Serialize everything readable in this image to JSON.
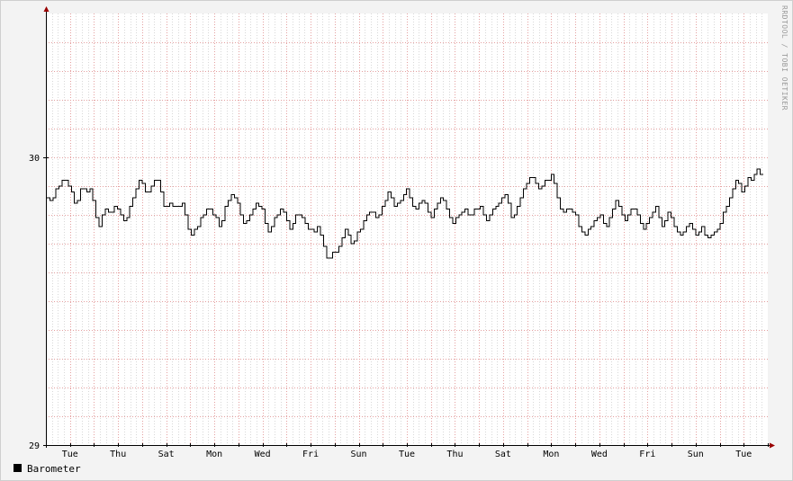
{
  "chart_data": {
    "type": "line",
    "watermark": "RRDTOOL / TOBI OETIKER",
    "x_tick_labels": [
      "Tue",
      "Thu",
      "Sat",
      "Mon",
      "Wed",
      "Fri",
      "Sun",
      "Tue",
      "Thu",
      "Sat",
      "Mon",
      "Wed",
      "Fri",
      "Sun",
      "Tue"
    ],
    "y_tick_labels": [
      "29",
      "30"
    ],
    "y_ticks": [
      29,
      30
    ],
    "ylim": [
      29,
      30.5
    ],
    "x_range_days": [
      0,
      30
    ],
    "x_tick_days": [
      1,
      3,
      5,
      7,
      9,
      11,
      13,
      15,
      17,
      19,
      21,
      23,
      25,
      27,
      29
    ],
    "grid": true,
    "legend_placement": "bottom-left",
    "colors": {
      "background": "#f3f3f3",
      "canvas": "#ffffff",
      "line": "#000000",
      "grid_minor": "#d8d8d8",
      "grid_major": "#e4a0a0",
      "axis": "#000000",
      "arrow": "#990000"
    },
    "series": [
      {
        "name": "Barometer",
        "color": "#000000",
        "values": [
          29.86,
          29.85,
          29.86,
          29.89,
          29.9,
          29.92,
          29.92,
          29.9,
          29.88,
          29.84,
          29.85,
          29.89,
          29.89,
          29.88,
          29.89,
          29.85,
          29.79,
          29.76,
          29.8,
          29.82,
          29.81,
          29.81,
          29.83,
          29.82,
          29.8,
          29.78,
          29.79,
          29.83,
          29.86,
          29.89,
          29.92,
          29.91,
          29.88,
          29.88,
          29.9,
          29.92,
          29.92,
          29.88,
          29.83,
          29.83,
          29.84,
          29.83,
          29.83,
          29.83,
          29.84,
          29.8,
          29.75,
          29.73,
          29.75,
          29.76,
          29.79,
          29.8,
          29.82,
          29.82,
          29.8,
          29.79,
          29.76,
          29.78,
          29.83,
          29.85,
          29.87,
          29.86,
          29.84,
          29.8,
          29.77,
          29.78,
          29.8,
          29.82,
          29.84,
          29.83,
          29.82,
          29.77,
          29.74,
          29.76,
          29.79,
          29.8,
          29.82,
          29.81,
          29.78,
          29.75,
          29.77,
          29.8,
          29.8,
          29.79,
          29.77,
          29.75,
          29.75,
          29.74,
          29.76,
          29.73,
          29.69,
          29.65,
          29.65,
          29.67,
          29.67,
          29.69,
          29.72,
          29.75,
          29.73,
          29.7,
          29.71,
          29.74,
          29.75,
          29.78,
          29.8,
          29.81,
          29.81,
          29.79,
          29.8,
          29.83,
          29.85,
          29.88,
          29.86,
          29.83,
          29.84,
          29.85,
          29.87,
          29.89,
          29.86,
          29.83,
          29.82,
          29.84,
          29.85,
          29.84,
          29.81,
          29.79,
          29.82,
          29.84,
          29.86,
          29.85,
          29.82,
          29.79,
          29.77,
          29.79,
          29.8,
          29.81,
          29.82,
          29.8,
          29.8,
          29.82,
          29.82,
          29.83,
          29.8,
          29.78,
          29.8,
          29.82,
          29.83,
          29.84,
          29.86,
          29.87,
          29.84,
          29.79,
          29.8,
          29.83,
          29.86,
          29.89,
          29.91,
          29.93,
          29.93,
          29.91,
          29.89,
          29.9,
          29.92,
          29.92,
          29.94,
          29.91,
          29.86,
          29.82,
          29.81,
          29.82,
          29.82,
          29.81,
          29.8,
          29.76,
          29.74,
          29.73,
          29.75,
          29.76,
          29.78,
          29.79,
          29.8,
          29.77,
          29.76,
          29.79,
          29.82,
          29.85,
          29.83,
          29.8,
          29.78,
          29.8,
          29.82,
          29.82,
          29.8,
          29.77,
          29.75,
          29.77,
          29.79,
          29.81,
          29.83,
          29.79,
          29.76,
          29.78,
          29.81,
          29.79,
          29.76,
          29.74,
          29.73,
          29.74,
          29.76,
          29.77,
          29.75,
          29.73,
          29.74,
          29.76,
          29.73,
          29.72,
          29.73,
          29.74,
          29.75,
          29.77,
          29.81,
          29.83,
          29.86,
          29.89,
          29.92,
          29.91,
          29.88,
          29.9,
          29.93,
          29.92,
          29.94,
          29.96,
          29.94
        ]
      }
    ]
  },
  "legend": [
    {
      "label": "Barometer",
      "color": "#000000"
    }
  ]
}
